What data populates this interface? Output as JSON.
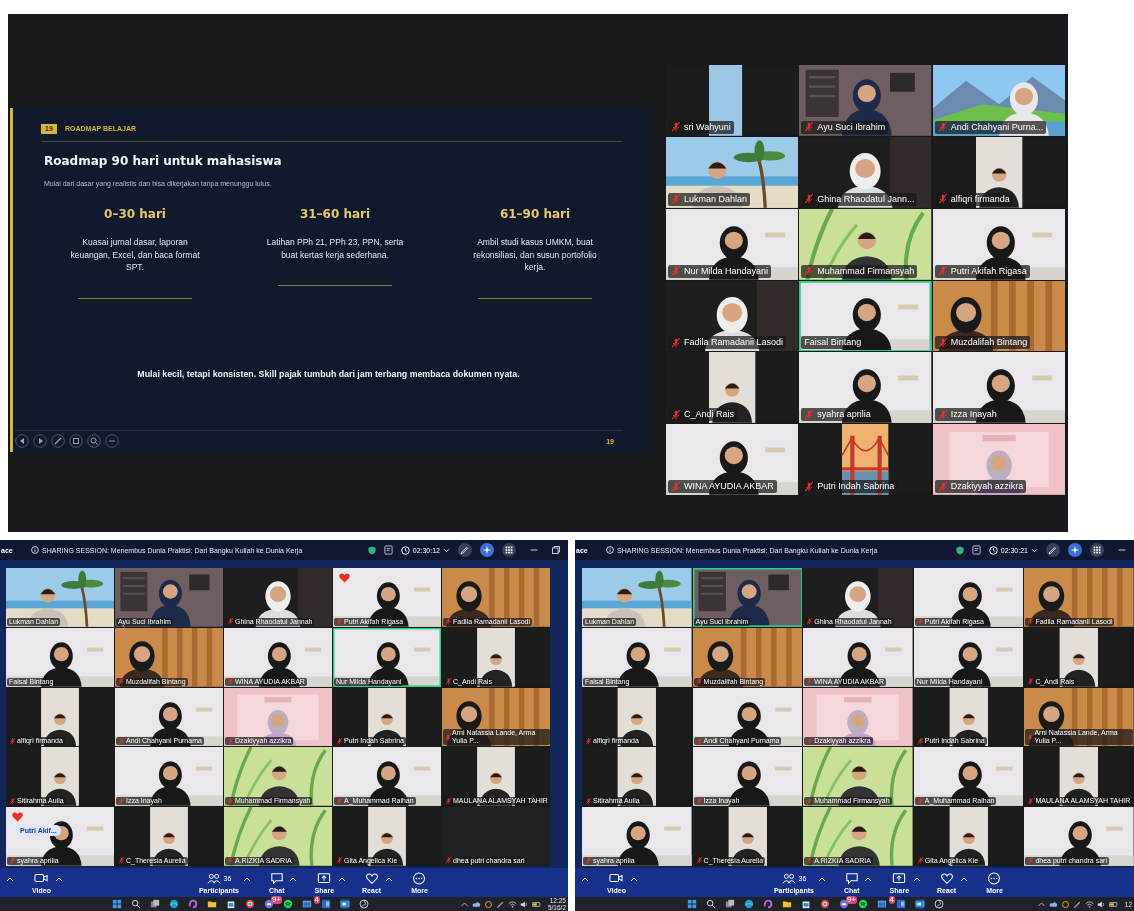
{
  "presentation": {
    "slide": {
      "badge": "19",
      "section": "ROADMAP BELAJAR",
      "title": "Roadmap 90 hari untuk mahasiswa",
      "subtitle": "Mulai dari dasar yang realistis dan bisa dikerjakan tanpa menunggu lulus.",
      "phases": [
        {
          "heading": "0–30 hari",
          "text": "Kuasai jurnal dasar, laporan keuangan, Excel, dan baca format SPT."
        },
        {
          "heading": "31–60 hari",
          "text": "Latihan PPh 21, PPh 23, PPN, serta buat kertas kerja sederhana."
        },
        {
          "heading": "61–90 hari",
          "text": "Ambil studi kasus UMKM, buat rekonsiliasi, dan susun portofolio kerja."
        }
      ],
      "quote": "Mulai kecil, tetapi konsisten. Skill pajak tumbuh dari jam terbang membaca dokumen nyata.",
      "page_number": "19"
    },
    "gallery": [
      {
        "name": "sri Wahyuni",
        "muted": true,
        "highlighted": false
      },
      {
        "name": "Ayu Suci Ibrahim",
        "muted": true,
        "highlighted": false
      },
      {
        "name": "Andi Chahyani Purna...",
        "muted": true,
        "highlighted": false
      },
      {
        "name": "Lukman Dahlan",
        "muted": true,
        "highlighted": false
      },
      {
        "name": "Ghina Rhaodatul Jann...",
        "muted": true,
        "highlighted": false
      },
      {
        "name": "alfiqri firmanda",
        "muted": true,
        "highlighted": false
      },
      {
        "name": "Nur Milda Handayani",
        "muted": true,
        "highlighted": false
      },
      {
        "name": "Muhammad Firmansyah",
        "muted": true,
        "highlighted": false
      },
      {
        "name": "Putri Akifah Rigasa",
        "muted": true,
        "highlighted": false
      },
      {
        "name": "Fadila Ramadanii Lasodi",
        "muted": true,
        "highlighted": false
      },
      {
        "name": "Faisal Bintang",
        "muted": false,
        "highlighted": true
      },
      {
        "name": "Muzdalifah Bintang",
        "muted": true,
        "highlighted": false
      },
      {
        "name": "C_Andi Rais",
        "muted": true,
        "highlighted": false
      },
      {
        "name": "syahra aprilia",
        "muted": true,
        "highlighted": false
      },
      {
        "name": "Izza Inayah",
        "muted": true,
        "highlighted": false
      },
      {
        "name": "WINA AYUDIA AKBAR",
        "muted": true,
        "highlighted": false
      },
      {
        "name": "Putri Indah Sabrina",
        "muted": true,
        "highlighted": false
      },
      {
        "name": "Dzakiyyah azzikra",
        "muted": true,
        "highlighted": false
      }
    ]
  },
  "meetings": [
    {
      "app_name": "ace",
      "title": "SHARING SESSION: Menembus Dunia Praktisi: Dari Bangku Kuliah ke Dunia Kerja",
      "timer": "02:30:12",
      "tiles": [
        {
          "name": "Lukman Dahlan",
          "muted": false,
          "highlighted": false,
          "heart": false
        },
        {
          "name": "Ayu Suci Ibrahim",
          "muted": false,
          "highlighted": false,
          "heart": false
        },
        {
          "name": "Ghina Rhaodatul Jannah",
          "muted": true,
          "highlighted": false,
          "heart": false
        },
        {
          "name": "Putri Akifah Rigasa",
          "muted": true,
          "highlighted": false,
          "heart": true
        },
        {
          "name": "Fadila Ramadanii Lasodi",
          "muted": true,
          "highlighted": false,
          "heart": false
        },
        {
          "name": "Faisal Bintang",
          "muted": false,
          "highlighted": false,
          "heart": false
        },
        {
          "name": "Muzdalifah Bintang",
          "muted": true,
          "highlighted": false,
          "heart": false
        },
        {
          "name": "WINA AYUDIA AKBAR",
          "muted": true,
          "highlighted": false,
          "heart": false
        },
        {
          "name": "Nur Milda Handayani",
          "muted": false,
          "highlighted": true,
          "heart": false
        },
        {
          "name": "C_Andi Rais",
          "muted": true,
          "highlighted": false,
          "heart": false
        },
        {
          "name": "alfiqri firmanda",
          "muted": true,
          "highlighted": false,
          "heart": false
        },
        {
          "name": "Andi Chahyani Purnama",
          "muted": true,
          "highlighted": false,
          "heart": false
        },
        {
          "name": "Dzakiyyah azzikra",
          "muted": true,
          "highlighted": false,
          "heart": false
        },
        {
          "name": "Putri Indah Sabrina",
          "muted": true,
          "highlighted": false,
          "heart": false
        },
        {
          "name": "Arni Natassia Lande, Arma Yulia P...",
          "muted": true,
          "highlighted": false,
          "heart": false
        },
        {
          "name": "Sitirahma Aulia",
          "muted": true,
          "highlighted": false,
          "heart": false
        },
        {
          "name": "Izza Inayah",
          "muted": true,
          "highlighted": false,
          "heart": false
        },
        {
          "name": "Muhammad Firmansyah",
          "muted": true,
          "highlighted": false,
          "heart": false
        },
        {
          "name": "A_Muhammad Raihan",
          "muted": true,
          "highlighted": false,
          "heart": false
        },
        {
          "name": "MAULANA ALAMSYAH TAHIR",
          "muted": true,
          "highlighted": false,
          "heart": false
        },
        {
          "name": "syahra aprilia",
          "muted": true,
          "highlighted": false,
          "heart": true,
          "bubble": "Putri Akif..."
        },
        {
          "name": "C_Theresia Aurelia",
          "muted": true,
          "highlighted": false,
          "heart": false
        },
        {
          "name": "A.RIZKIA SADRIA",
          "muted": true,
          "highlighted": false,
          "heart": false
        },
        {
          "name": "Gita Angelica Kie",
          "muted": true,
          "highlighted": false,
          "heart": false
        },
        {
          "name": "dhea putri chandra sari",
          "muted": true,
          "highlighted": false,
          "heart": false
        }
      ],
      "toolbar": [
        {
          "kind": "video",
          "label": "Video"
        },
        {
          "kind": "participants",
          "label": "Participants",
          "count": "36"
        },
        {
          "kind": "chat",
          "label": "Chat"
        },
        {
          "kind": "share",
          "label": "Share"
        },
        {
          "kind": "react",
          "label": "React"
        },
        {
          "kind": "more",
          "label": "More"
        }
      ],
      "taskbar": {
        "badges": [
          "9+",
          "4"
        ],
        "time": "12:25",
        "date": "5/16/2"
      }
    },
    {
      "app_name": "ace",
      "title": "SHARING SESSION: Menembus Dunia Praktisi: Dari Bangku Kuliah ke Dunia Kerja",
      "timer": "02:30:21",
      "tiles": [
        {
          "name": "Lukman Dahlan",
          "muted": false,
          "highlighted": false,
          "heart": false
        },
        {
          "name": "Ayu Suci Ibrahim",
          "muted": false,
          "highlighted": true,
          "heart": false
        },
        {
          "name": "Ghina Rhaodatul Jannah",
          "muted": true,
          "highlighted": false,
          "heart": false
        },
        {
          "name": "Putri Akifah Rigasa",
          "muted": true,
          "highlighted": false,
          "heart": false
        },
        {
          "name": "Fadila Ramadanii Lasodi",
          "muted": true,
          "highlighted": false,
          "heart": false
        },
        {
          "name": "Faisal Bintang",
          "muted": false,
          "highlighted": false,
          "heart": false
        },
        {
          "name": "Muzdalifah Bintang",
          "muted": true,
          "highlighted": false,
          "heart": false
        },
        {
          "name": "WINA AYUDIA AKBAR",
          "muted": true,
          "highlighted": false,
          "heart": false
        },
        {
          "name": "Nur Milda Handayani",
          "muted": false,
          "highlighted": false,
          "heart": false
        },
        {
          "name": "C_Andi Rais",
          "muted": true,
          "highlighted": false,
          "heart": false
        },
        {
          "name": "alfiqri firmanda",
          "muted": true,
          "highlighted": false,
          "heart": false
        },
        {
          "name": "Andi Chahyani Purnama",
          "muted": true,
          "highlighted": false,
          "heart": false
        },
        {
          "name": "Dzakiyyah azzikra",
          "muted": true,
          "highlighted": false,
          "heart": false
        },
        {
          "name": "Putri Indah Sabrina",
          "muted": true,
          "highlighted": false,
          "heart": false
        },
        {
          "name": "Arni Natassia Lande, Arma Yulia P...",
          "muted": true,
          "highlighted": false,
          "heart": false
        },
        {
          "name": "Sitirahma Aulia",
          "muted": true,
          "highlighted": false,
          "heart": false
        },
        {
          "name": "Izza Inayah",
          "muted": true,
          "highlighted": false,
          "heart": false
        },
        {
          "name": "Muhammad Firmansyah",
          "muted": true,
          "highlighted": false,
          "heart": false
        },
        {
          "name": "A_Muhammad Raihan",
          "muted": true,
          "highlighted": false,
          "heart": false
        },
        {
          "name": "MAULANA ALAMSYAH TAHIR",
          "muted": true,
          "highlighted": false,
          "heart": false
        },
        {
          "name": "syahra aprilia",
          "muted": true,
          "highlighted": false,
          "heart": false
        },
        {
          "name": "C_Theresia Aurelia",
          "muted": true,
          "highlighted": false,
          "heart": false
        },
        {
          "name": "A.RIZKIA SADRIA",
          "muted": true,
          "highlighted": false,
          "heart": false
        },
        {
          "name": "Gita Angelica Kie",
          "muted": true,
          "highlighted": false,
          "heart": false
        },
        {
          "name": "dhea putri chandra sari",
          "muted": true,
          "highlighted": false,
          "heart": false
        }
      ],
      "toolbar": [
        {
          "kind": "video",
          "label": "Video"
        },
        {
          "kind": "participants",
          "label": "Participants",
          "count": "36"
        },
        {
          "kind": "chat",
          "label": "Chat"
        },
        {
          "kind": "share",
          "label": "Share"
        },
        {
          "kind": "react",
          "label": "React"
        },
        {
          "kind": "more",
          "label": "More"
        }
      ],
      "taskbar": {
        "badges": [
          "9+",
          "4"
        ],
        "time": "12"
      }
    }
  ]
}
